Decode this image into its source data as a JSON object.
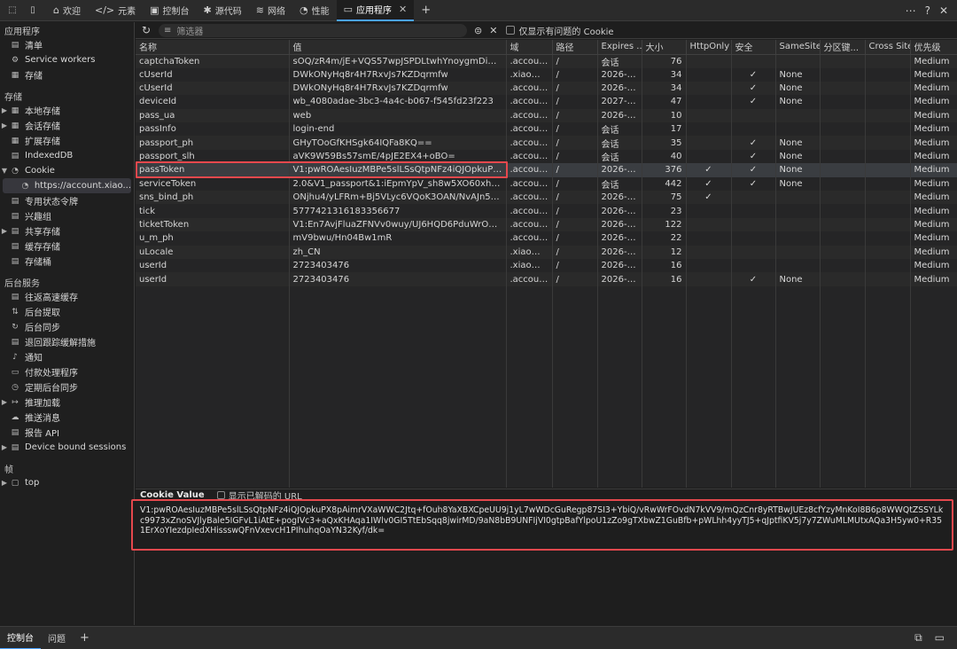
{
  "topbar": {
    "tabs": [
      {
        "label": "欢迎",
        "icon": "home-icon",
        "glyph": "⌂"
      },
      {
        "label": "元素",
        "icon": "code-icon",
        "glyph": "</>"
      },
      {
        "label": "控制台",
        "icon": "console-icon",
        "glyph": "▣"
      },
      {
        "label": "源代码",
        "icon": "bug-icon",
        "glyph": "✱"
      },
      {
        "label": "网络",
        "icon": "wifi-icon",
        "glyph": "≋"
      },
      {
        "label": "性能",
        "icon": "performance-icon",
        "glyph": "◔"
      },
      {
        "label": "应用程序",
        "icon": "application-icon",
        "glyph": "▭",
        "active": true
      }
    ]
  },
  "sidebar": {
    "application": {
      "heading": "应用程序",
      "items": [
        "清单",
        "Service workers",
        "存储"
      ]
    },
    "storage": {
      "heading": "存储",
      "items": [
        "本地存储",
        "会话存储",
        "扩展存储",
        "IndexedDB",
        "Cookie",
        "https://account.xiao...",
        "专用状态令牌",
        "兴趣组",
        "共享存储",
        "缓存存储",
        "存储桶"
      ]
    },
    "background": {
      "heading": "后台服务",
      "items": [
        "往返高速缓存",
        "后台提取",
        "后台同步",
        "退回跟踪缓解措施",
        "通知",
        "付款处理程序",
        "定期后台同步",
        "推理加载",
        "推送消息",
        "报告 API",
        "Device bound sessions"
      ]
    },
    "frames": {
      "heading": "帧",
      "items": [
        "top"
      ]
    }
  },
  "filter": {
    "placeholder": "筛选器",
    "only_issues_label": "仅显示有问题的 Cookie"
  },
  "table": {
    "headers": [
      "名称",
      "值",
      "域",
      "路径",
      "Expires ...",
      "大小",
      "HttpOnly",
      "安全",
      "SameSite",
      "分区键...",
      "Cross Site",
      "优先级"
    ],
    "rows": [
      [
        "captchaToken",
        "sOQ/zR4m/jE+VQS57wpJSPDLtwhYnoygmDiNSwrm...",
        ".accoun...",
        "/",
        "会话",
        "76",
        "",
        "",
        "",
        "",
        "",
        "Medium"
      ],
      [
        "cUserId",
        "DWkONyHq8r4H7RxvJs7KZDqrmfw",
        ".xiaomi....",
        "/",
        "2026-0...",
        "34",
        "",
        "✓",
        "None",
        "",
        "",
        "Medium"
      ],
      [
        "cUserId",
        "DWkONyHq8r4H7RxvJs7KZDqrmfw",
        ".accoun...",
        "/",
        "2026-0...",
        "34",
        "",
        "✓",
        "None",
        "",
        "",
        "Medium"
      ],
      [
        "deviceId",
        "wb_4080adae-3bc3-4a4c-b067-f545fd23f223",
        ".accoun...",
        "/",
        "2027-0...",
        "47",
        "",
        "✓",
        "None",
        "",
        "",
        "Medium"
      ],
      [
        "pass_ua",
        "web",
        ".accoun...",
        "/",
        "2026-0...",
        "10",
        "",
        "",
        "",
        "",
        "",
        "Medium"
      ],
      [
        "passInfo",
        "login-end",
        ".accoun...",
        "/",
        "会话",
        "17",
        "",
        "",
        "",
        "",
        "",
        "Medium"
      ],
      [
        "passport_ph",
        "GHyTOoGfKHSgk64IQFa8KQ==",
        ".accoun...",
        "/",
        "会话",
        "35",
        "",
        "✓",
        "None",
        "",
        "",
        "Medium"
      ],
      [
        "passport_slh",
        "aVK9W59Bs57smE/4pJE2EX4+oBO=",
        ".accoun...",
        "/",
        "会话",
        "40",
        "",
        "✓",
        "None",
        "",
        "",
        "Medium"
      ],
      [
        "passToken",
        "V1:pwROAesIuzMBPe5slLSsQtpNFz4iQJOpkuPX8pAi...",
        ".accoun...",
        "/",
        "2026-0...",
        "376",
        "✓",
        "✓",
        "None",
        "",
        "",
        "Medium"
      ],
      [
        "serviceToken",
        "2.0&V1_passport&1:iEpmYpV_sh8w5XO60xh7pQ:22...",
        ".accoun...",
        "/",
        "会话",
        "442",
        "✓",
        "✓",
        "None",
        "",
        "",
        "Medium"
      ],
      [
        "sns_bind_ph",
        "ONjhu4/yLFRm+Bj5VLyc6VQoK3OAN/NvAJn5mNe...",
        ".accoun...",
        "/",
        "2026-0...",
        "75",
        "✓",
        "",
        "",
        "",
        "",
        "Medium"
      ],
      [
        "tick",
        "5777421316183356677",
        ".accoun...",
        "/",
        "2026-0...",
        "23",
        "",
        "",
        "",
        "",
        "",
        "Medium"
      ],
      [
        "ticketToken",
        "V1:En7AvjFluaZFNVv0wuy/UJ6HQD6PduWrOdnX0m...",
        ".accoun...",
        "/",
        "2026-0...",
        "122",
        "",
        "",
        "",
        "",
        "",
        "Medium"
      ],
      [
        "u_m_ph",
        "mV9bwu/Hn04Bw1mR",
        ".accoun...",
        "/",
        "2026-0...",
        "22",
        "",
        "",
        "",
        "",
        "",
        "Medium"
      ],
      [
        "uLocale",
        "zh_CN",
        ".xiaomi....",
        "/",
        "2026-0...",
        "12",
        "",
        "",
        "",
        "",
        "",
        "Medium"
      ],
      [
        "userId",
        "2723403476",
        ".xiaomi....",
        "/",
        "2026-0...",
        "16",
        "",
        "",
        "",
        "",
        "",
        "Medium"
      ],
      [
        "userId",
        "2723403476",
        ".accoun...",
        "/",
        "2026-0...",
        "16",
        "",
        "✓",
        "None",
        "",
        "",
        "Medium"
      ]
    ]
  },
  "cookie_value": {
    "title": "Cookie Value",
    "decode_label": "显示已解码的 URL",
    "value": "V1:pwROAesIuzMBPe5slLSsQtpNFz4iQJOpkuPX8pAimrVXaWWC2Jtq+fOuh8YaXBXCpeUU9j1yL7wWDcGuRegp87SI3+YbiQ/vRwWrFOvdN7kVV9/mQzCnr8yRTBwJUEz8cfYzyMnKoI8B6p8WWQtZSSYLkc9973xZnoSVJlyBale5IGFvL1iAtE+pogIVc3+aQxKHAqa1IWlv0GI5TtEbSqq8jwirMD/9aN8bB9UNFIjVI0gtpBafYlpoU1zZo9gTXbwZ1GuBfb+pWLhh4yyTJ5+qJptfiKV5j7y7ZWuMLMUtxAQa3H5yw0+R351ErXoYIezdpIedXHissswQFnVxevcH1PIhuhqOaYN32Kyf/dk="
  },
  "bottombar": {
    "tabs": [
      "控制台",
      "问题"
    ]
  }
}
